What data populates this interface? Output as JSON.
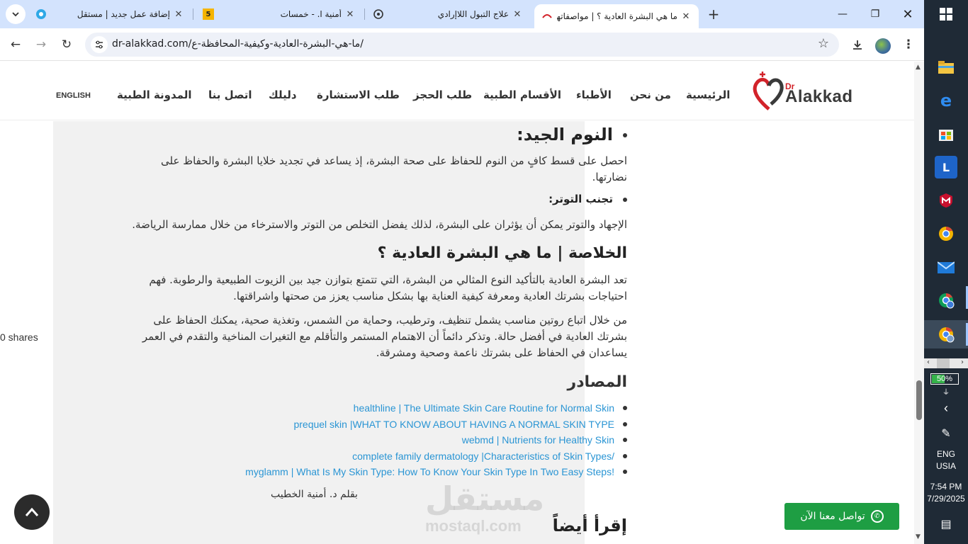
{
  "browser": {
    "tabs": [
      {
        "title": "إضافة عمل جديد | مستقل"
      },
      {
        "title": "أمنية ا. - خمسات",
        "badge": "5"
      },
      {
        "title": "علاج التبول اللاإرادي"
      },
      {
        "title": "ما هي البشرة العادية ؟ | مواصفاتها",
        "active": true
      }
    ],
    "url": "dr-alakkad.com/ما-هي-البشرة-العادية-وكيفية-المحافظة-ع/"
  },
  "site": {
    "logo_dr": "Dr",
    "logo_name": "Alakkad",
    "nav": [
      "الرئيسية",
      "من نحن",
      "الأطباء",
      "الأقسام الطبية",
      "طلب الحجز",
      "طلب الاستشارة",
      "دليلك",
      "اتصل بنا",
      "المدونة الطبية"
    ],
    "lang_switch": "ENGLISH"
  },
  "article": {
    "sleep_heading": "النوم الجيد:",
    "sleep_text": "احصل على قسط كافٍ من النوم للحفاظ على صحة البشرة، إذ يساعد في تجديد خلايا البشرة والحفاظ على نضارتها.",
    "stress_heading": "تجنب التوتر:",
    "stress_text": "الإجهاد والتوتر يمكن أن يؤثران على البشرة، لذلك يفضل التخلص من التوتر والاسترخاء من خلال ممارسة الرياضة.",
    "summary_heading": "الخلاصة | ما هي البشرة العادية ؟",
    "summary_text_1": "تعد البشرة العادية بالتأكيد النوع المثالي من البشرة، التي تتمتع بتوازن جيد بين الزيوت الطبيعية والرطوبة. فهم احتياجات بشرتك العادية ومعرفة كيفية العناية بها بشكل مناسب يعزز من صحتها واشراقتها.",
    "summary_text_2": "من خلال اتباع روتين مناسب يشمل تنظيف، وترطيب، وحماية من الشمس، وتغذية صحية، يمكنك الحفاظ على بشرتك العادية في أفضل حالة. وتذكر دائماً أن الاهتمام المستمر والتأقلم مع التغيرات المناخية والتقدم في العمر يساعدان في الحفاظ على بشرتك ناعمة وصحية ومشرقة.",
    "sources_heading": "المصادر",
    "sources": [
      "healthline | The Ultimate Skin Care Routine for Normal Skin",
      "prequel skin |WHAT TO KNOW ABOUT HAVING A NORMAL SKIN TYPE",
      "webmd | Nutrients for Healthy Skin",
      "complete family dermatology |Characteristics of Skin Types/",
      "myglamm | What Is My Skin Type: How To Know Your Skin Type In Two Easy Steps!"
    ],
    "author": "بقلم د. أمنية الخطيب",
    "read_also": "إقرأ أيضاً"
  },
  "watermark": {
    "ar": "مستقل",
    "en": "mostaql.com"
  },
  "shares": "0 shares",
  "whatsapp_label": "تواصل معنا الآن",
  "taskbar": {
    "battery": "50%",
    "lang_line1": "ENG",
    "lang_line2": "USIA",
    "time": "7:54 PM",
    "date": "7/29/2025"
  },
  "colors": {
    "accent_link": "#2a95d4",
    "whatsapp": "#1e9e43",
    "brand_red": "#d2232a"
  }
}
